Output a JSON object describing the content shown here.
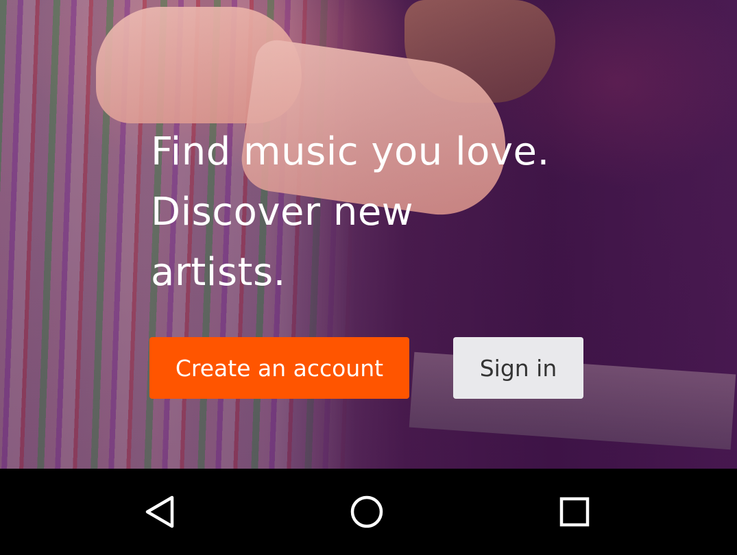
{
  "hero": {
    "tagline": "Find music you love.\nDiscover new\nartists."
  },
  "buttons": {
    "create_account": "Create an account",
    "sign_in": "Sign in"
  },
  "nav": {
    "back_icon": "back-triangle-icon",
    "home_icon": "home-circle-icon",
    "recents_icon": "recents-square-icon"
  },
  "colors": {
    "accent": "#ff5500",
    "sign_in_bg": "#e9e9ec",
    "nav_bg": "#000000"
  }
}
